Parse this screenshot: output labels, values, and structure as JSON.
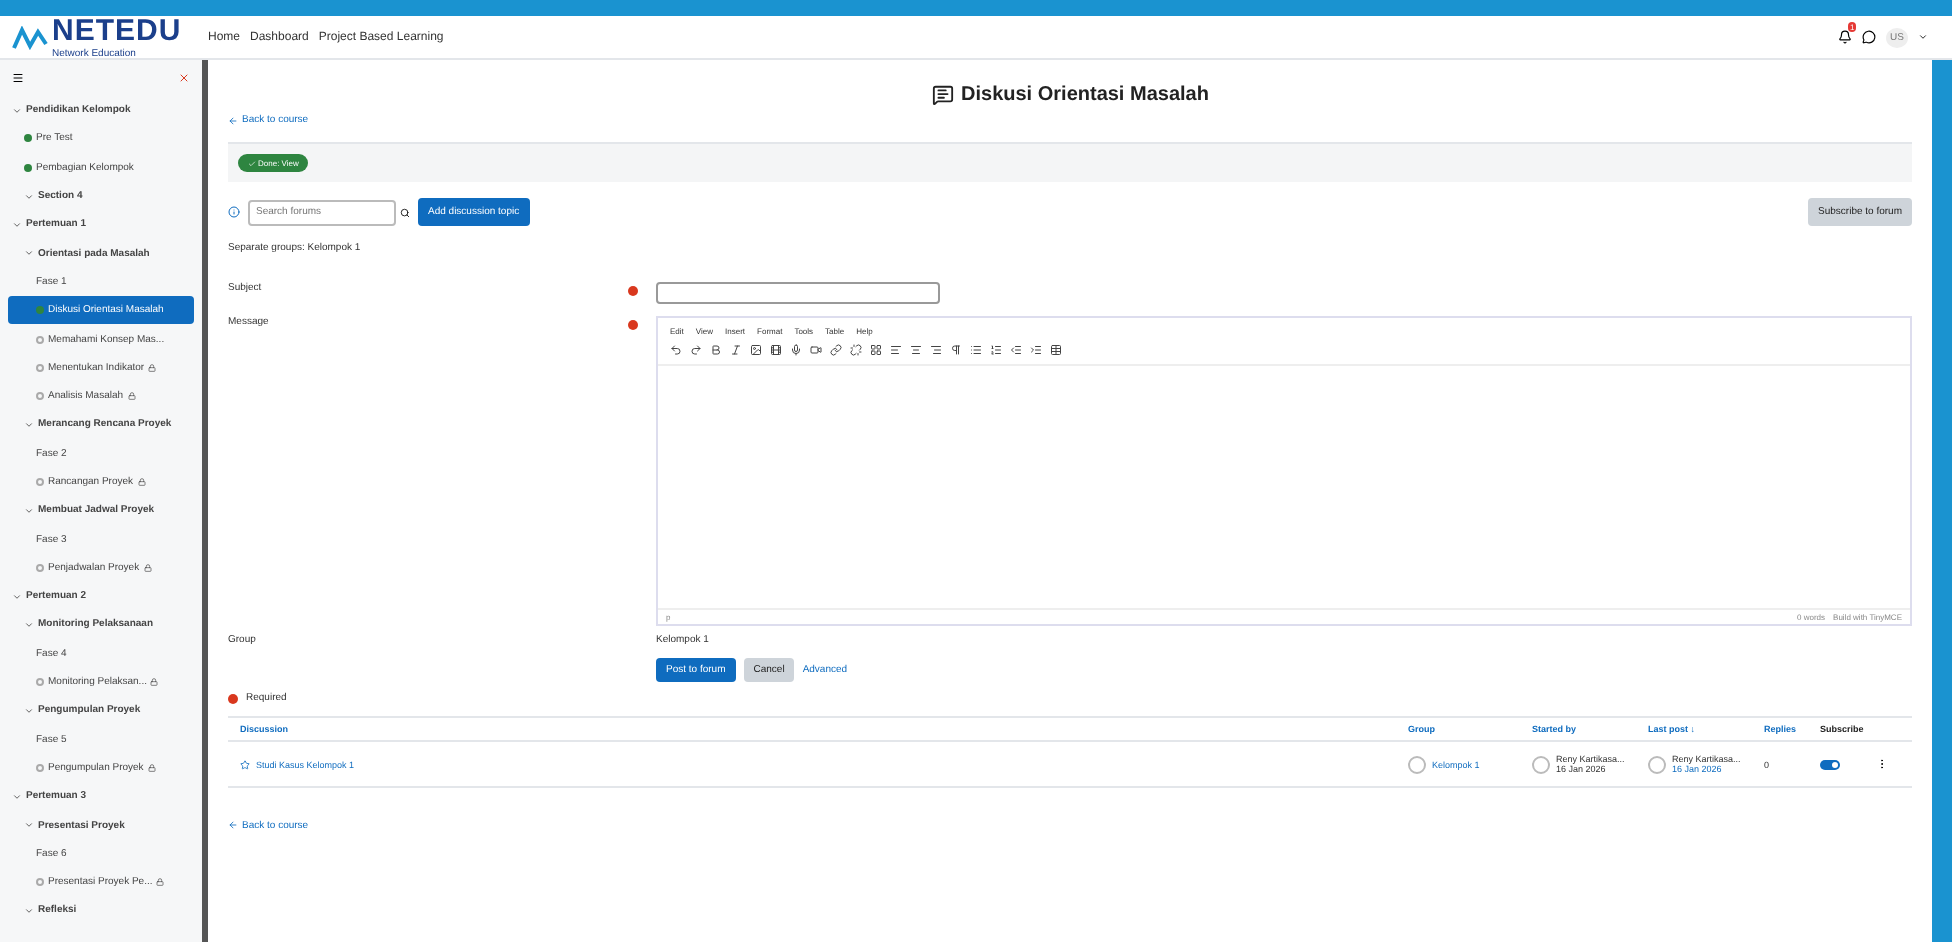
{
  "logo": {
    "text": "NETEDU",
    "subtitle": "Network Education"
  },
  "breadcrumb": [
    "Home",
    "Dashboard",
    "Project Based Learning"
  ],
  "user_menu": {
    "initials": "US",
    "notifications": "1"
  },
  "sidebar": {
    "items": [
      {
        "label": "Pendidikan Kelompok",
        "kind": "section",
        "selected": false,
        "children": [
          {
            "label": "Pre Test",
            "kind": "activity",
            "selected": false,
            "done": true,
            "locked": false
          },
          {
            "label": "Pembagian Kelompok",
            "kind": "activity",
            "selected": false,
            "done": true,
            "locked": false
          },
          {
            "label": "Section 4",
            "kind": "subsection",
            "selected": false
          }
        ]
      },
      {
        "label": "Pertemuan 1",
        "kind": "section",
        "selected": false,
        "children": [
          {
            "label": "Orientasi pada Masalah",
            "kind": "subsection",
            "selected": false,
            "children": [
              {
                "label": "Fase 1",
                "kind": "page",
                "selected": false
              },
              {
                "label": "Diskusi Orientasi Masalah",
                "kind": "activity",
                "selected": true,
                "done": true,
                "locked": false
              },
              {
                "label": "Memahami Konsep Mas...",
                "kind": "activity",
                "selected": false,
                "done": false,
                "locked": false
              },
              {
                "label": "Menentukan Indikator",
                "kind": "activity",
                "selected": false,
                "done": false,
                "locked": true
              },
              {
                "label": "Analisis Masalah",
                "kind": "activity",
                "selected": false,
                "done": false,
                "locked": true
              }
            ]
          },
          {
            "label": "Merancang Rencana Proyek",
            "kind": "subsection",
            "selected": false,
            "children": [
              {
                "label": "Fase 2",
                "kind": "page",
                "selected": false
              },
              {
                "label": "Rancangan Proyek",
                "kind": "activity",
                "selected": false,
                "done": false,
                "locked": true
              }
            ]
          },
          {
            "label": "Membuat Jadwal Proyek",
            "kind": "subsection",
            "selected": false,
            "children": [
              {
                "label": "Fase 3",
                "kind": "page",
                "selected": false
              },
              {
                "label": "Penjadwalan Proyek",
                "kind": "activity",
                "selected": false,
                "done": false,
                "locked": true
              }
            ]
          }
        ]
      },
      {
        "label": "Pertemuan 2",
        "kind": "section",
        "selected": false,
        "children": [
          {
            "label": "Monitoring Pelaksanaan",
            "kind": "subsection",
            "selected": false,
            "children": [
              {
                "label": "Fase 4",
                "kind": "page",
                "selected": false
              },
              {
                "label": "Monitoring Pelaksan...",
                "kind": "activity",
                "selected": false,
                "done": false,
                "locked": true
              }
            ]
          },
          {
            "label": "Pengumpulan Proyek",
            "kind": "subsection",
            "selected": false,
            "children": [
              {
                "label": "Fase 5",
                "kind": "page",
                "selected": false
              },
              {
                "label": "Pengumpulan Proyek",
                "kind": "activity",
                "selected": false,
                "done": false,
                "locked": true
              }
            ]
          }
        ]
      },
      {
        "label": "Pertemuan 3",
        "kind": "section",
        "selected": false,
        "children": [
          {
            "label": "Presentasi Proyek",
            "kind": "subsection",
            "selected": false,
            "children": [
              {
                "label": "Fase 6",
                "kind": "page",
                "selected": false
              },
              {
                "label": "Presentasi Proyek Pe...",
                "kind": "activity",
                "selected": false,
                "done": false,
                "locked": true
              }
            ]
          },
          {
            "label": "Refleksi",
            "kind": "subsection",
            "selected": false
          }
        ]
      }
    ]
  },
  "page": {
    "title": "Diskusi Orientasi Masalah",
    "back_link": "Back to course",
    "completion": "Done: View",
    "search": {
      "placeholder": "Search forums"
    },
    "add_button": "Add discussion topic",
    "subscribe_button": "Subscribe to forum",
    "groups_note": "Separate groups: Kelompok 1"
  },
  "form": {
    "subject": {
      "label": "Subject"
    },
    "message": {
      "label": "Message"
    },
    "editor_menu": [
      "Edit",
      "View",
      "Insert",
      "Format",
      "Tools",
      "Table",
      "Help"
    ],
    "editor_path": "p",
    "editor_status": "0 words",
    "editor_brand": "Build with TinyMCE",
    "group": {
      "label": "Group",
      "value": "Kelompok 1"
    },
    "buttons": [
      "Post to forum",
      "Cancel"
    ],
    "advanced_link": "Advanced",
    "required_note": "Required"
  },
  "table": {
    "columns": [
      "Discussion",
      "Group",
      "Started by",
      "Last post ↓",
      "Replies",
      "Subscribe"
    ],
    "rows": [
      {
        "discussion": "Studi Kasus Kelompok 1",
        "starred": false,
        "group": "Kelompok 1",
        "started_by": "Reny Kartikasa...",
        "started_date": "16 Jan 2026",
        "last_by": "Reny Kartikasa...",
        "last_date": "16 Jan 2026",
        "replies": "0",
        "subscribed": true
      }
    ]
  },
  "footer_link": "Back to course"
}
